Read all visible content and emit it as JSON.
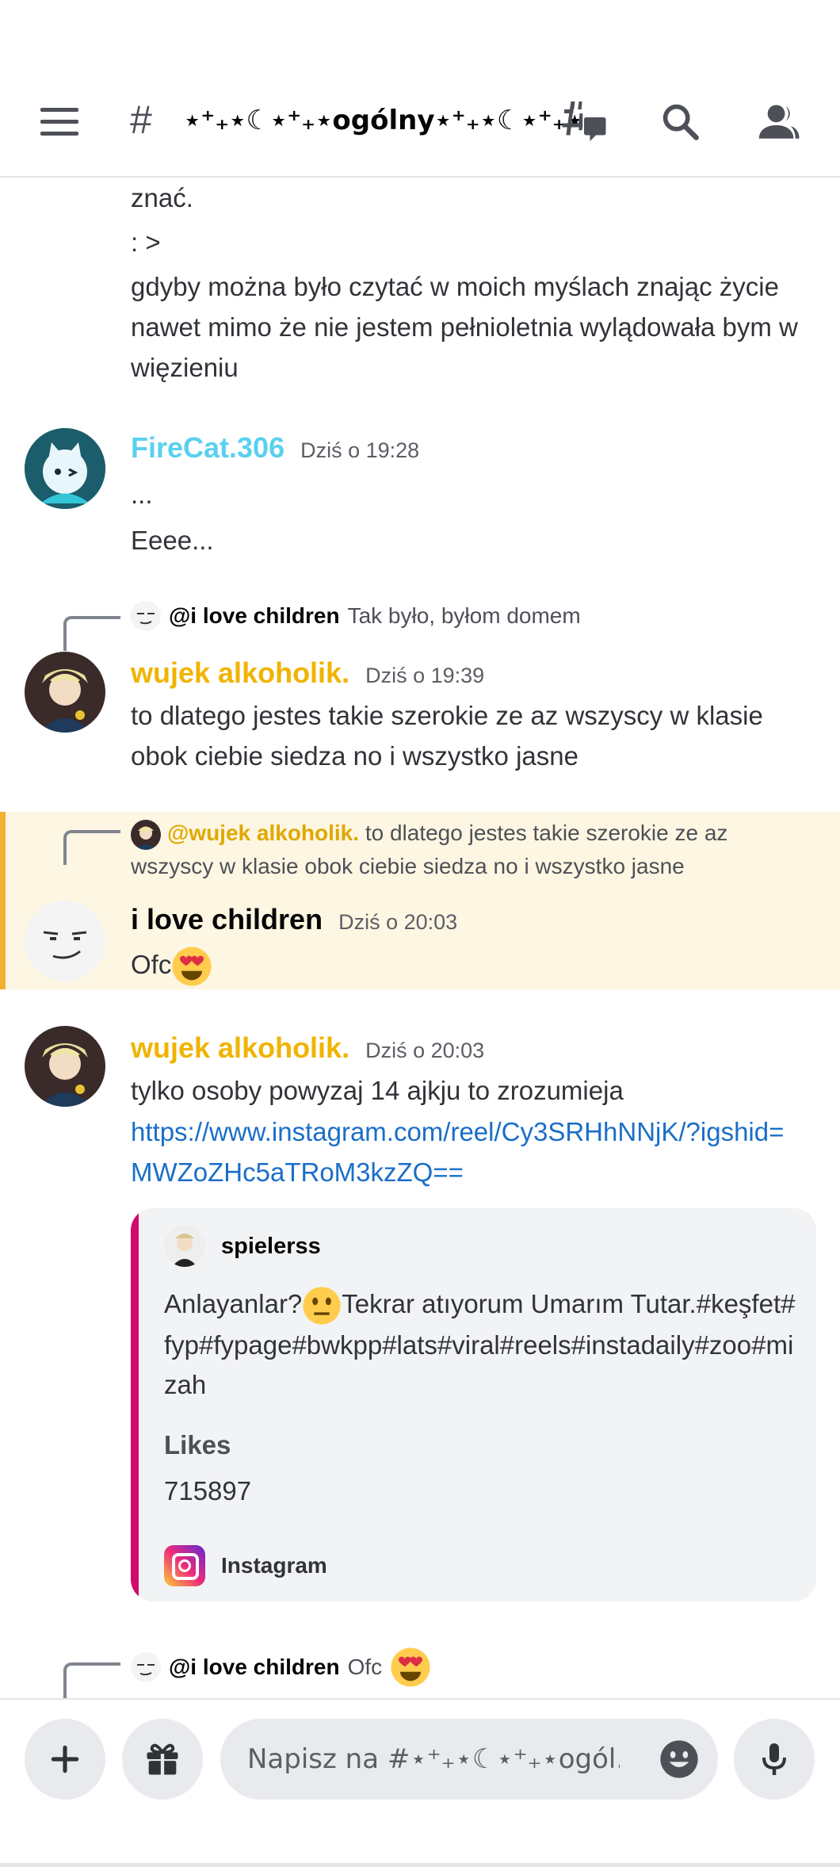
{
  "header": {
    "hash": "#",
    "channel_name": "⋆⁺₊⋆☾⋆⁺₊⋆ogólny⋆⁺₊⋆☾⋆⁺₊⋆"
  },
  "messages": {
    "prev": {
      "line1": "znać.",
      "line2": ": >",
      "line3": "gdyby można było czytać w moich myślach znając życie nawet mimo że nie jestem pełnioletnia wylądowała bym w więzieniu"
    },
    "firecat": {
      "author": "FireCat.306",
      "author_color": "#5ad0f0",
      "time": "Dziś o 19:28",
      "line1": "...",
      "line2": "Eeee..."
    },
    "wujek1": {
      "reply_name": "@i love children",
      "reply_text": "Tak było, byłom domem",
      "author": "wujek alkoholik.",
      "author_color": "#f0b400",
      "time": "Dziś o 19:39",
      "text": "to dlatego jestes takie szerokie ze az wszyscy w klasie obok ciebie siedza no i wszystko jasne"
    },
    "ilove": {
      "reply_name": "@wujek alkoholik.",
      "reply_text": "to dlatego jestes takie szerokie ze az",
      "reply_text2": "wszyscy w klasie obok ciebie siedza no i wszystko jasne",
      "author": "i love children",
      "time": "Dziś o 20:03",
      "text": "Ofc"
    },
    "wujek2": {
      "author": "wujek alkoholik.",
      "time": "Dziś o 20:03",
      "text": "tylko osoby powyzaj 14 ajkju to zrozumieja",
      "link1": "https://www.instagram.com/reel/Cy3SRHhNNjK/?igshid=",
      "link2": "MWZoZHc5aTRoM3kzZQ==",
      "embed": {
        "author": "spielerss",
        "desc_a": "Anlayanlar?",
        "desc_b": "Tekrar atıyorum Umarım Tutar.#keşfet#fyp#fypage#bwkpp#lats#viral#reels#instadaily#zoo#mizah",
        "field_name": "Likes",
        "field_value": "715897",
        "footer": "Instagram"
      }
    },
    "next": {
      "reply_name": "@i love children",
      "reply_text": "Ofc"
    }
  },
  "composer": {
    "placeholder": "Napisz na #⋆⁺₊⋆☾⋆⁺₊⋆ogól..."
  },
  "colors": {
    "accent_highlight": "#f0b232",
    "embed_bar": "#d10a6f",
    "link": "#1a6ec8"
  },
  "icons": [
    "hamburger-icon",
    "threads-icon",
    "search-icon",
    "members-icon",
    "plus-icon",
    "gift-icon",
    "emoji-icon",
    "microphone-icon",
    "instagram-icon"
  ]
}
